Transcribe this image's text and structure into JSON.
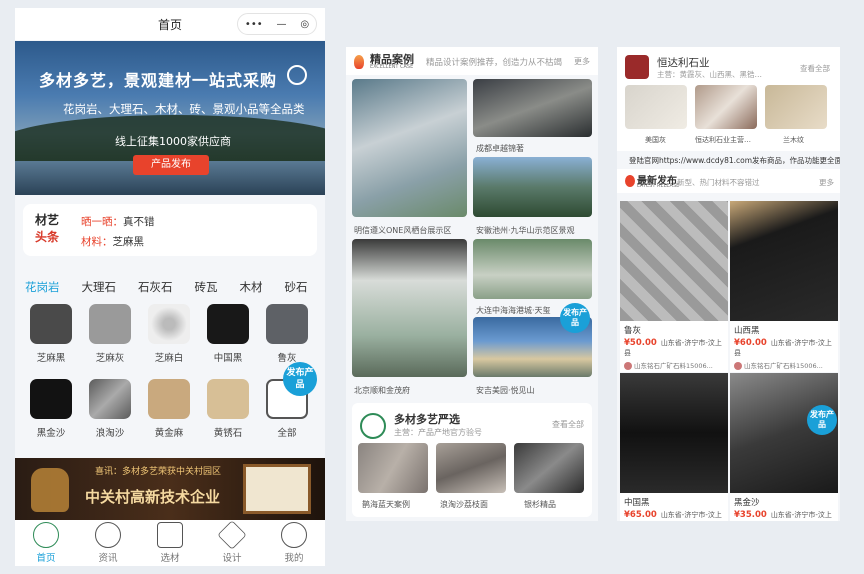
{
  "panel1": {
    "title": "首页",
    "capsule": {
      "more": "•••",
      "minus": "—",
      "target": "◎"
    },
    "banner": {
      "headline": "多材多艺，景观建材一站式采购",
      "line2": "花岗岩、大理石、木材、砖、景观小品等全品类",
      "line3": "线上征集1000家供应商",
      "button": "产品发布"
    },
    "news": {
      "logo_top": "材艺",
      "logo_bottom": "头条",
      "items": [
        {
          "tag": "晒一晒：",
          "text": "真不错"
        },
        {
          "tag": "材料：",
          "text": "芝麻黑"
        }
      ]
    },
    "categories": [
      "花岗岩",
      "大理石",
      "石灰石",
      "砖瓦",
      "木材",
      "砂石"
    ],
    "products": [
      {
        "label": "芝麻黑",
        "color": "#4a4a4a"
      },
      {
        "label": "芝麻灰",
        "color": "#9a9a9a"
      },
      {
        "label": "芝麻白",
        "color": "#d8d8d8"
      },
      {
        "label": "中国黑",
        "color": "#181818"
      },
      {
        "label": "鲁灰",
        "color": "#5e6166"
      },
      {
        "label": "黑金沙",
        "color": "#121212"
      },
      {
        "label": "浪淘沙",
        "color": "#7c7c7c"
      },
      {
        "label": "黄金麻",
        "color": "#c9a97e"
      },
      {
        "label": "黄锈石",
        "color": "#d7bf96"
      },
      {
        "label": "全部",
        "color": "#ffffff"
      }
    ],
    "fab": "发布产品",
    "ad": {
      "line1": "喜讯：多材多艺荣获中关村园区",
      "line2": "中关村高新技术企业"
    },
    "tabs": [
      {
        "label": "首页",
        "icon": "home-icon"
      },
      {
        "label": "资讯",
        "icon": "news-icon"
      },
      {
        "label": "选材",
        "icon": "grid-icon"
      },
      {
        "label": "设计",
        "icon": "design-icon"
      },
      {
        "label": "我的",
        "icon": "user-icon"
      }
    ]
  },
  "panel2": {
    "title": "精品案例",
    "title_en": "EXCELLENT CASE",
    "subtitle": "精品设计案例推荐，创造力从不枯竭",
    "more": "更多",
    "cases": [
      {
        "caption": "明信遵义ONE风栖台展示区"
      },
      {
        "caption": "成都卓越锦著"
      },
      {
        "caption": "安徽池州·九华山示范区景观"
      },
      {
        "caption": "大连中海海港城·天玺"
      },
      {
        "caption": "北京顺和金茂府"
      },
      {
        "caption": "安吉美园·悦见山"
      }
    ],
    "fab": "发布产品",
    "select": {
      "title": "多材多艺严选",
      "sub": "主营：产品产地官方验号",
      "more": "查看全部",
      "items": [
        "鹊海蓝天案例",
        "浪淘沙荔枝面",
        "银杉精品"
      ]
    }
  },
  "panel3": {
    "company": "恒达利石业",
    "company_sub": "主营：黄霞灰、山西黑、黑锆…",
    "more_all": "查看全部",
    "thumbs": [
      "美国灰",
      "恒达利石业主营…",
      "兰木纹"
    ],
    "notice": "登陆官网https://www.dcdy81.com发布商品，作品功能更全面",
    "latest": {
      "title": "最新发布",
      "title_en": "LATEST RELEASE",
      "sub": "新型、热门材料不容错过",
      "more": "更多"
    },
    "fab": "发布产品",
    "items": [
      {
        "name": "鲁灰",
        "price": "¥50.00",
        "loc": "山东省-济宁市-汶上县",
        "seller": "山东铭石广矿石料15006..."
      },
      {
        "name": "山西黑",
        "price": "¥60.00",
        "loc": "山东省-济宁市-汶上县",
        "seller": "山东铭石广矿石料15006..."
      },
      {
        "name": "中国黑",
        "price": "¥65.00",
        "loc": "山东省-济宁市-汶上县",
        "seller": ""
      },
      {
        "name": "黑金沙",
        "price": "¥35.00",
        "loc": "山东省-济宁市-汶上县",
        "seller": ""
      }
    ]
  }
}
